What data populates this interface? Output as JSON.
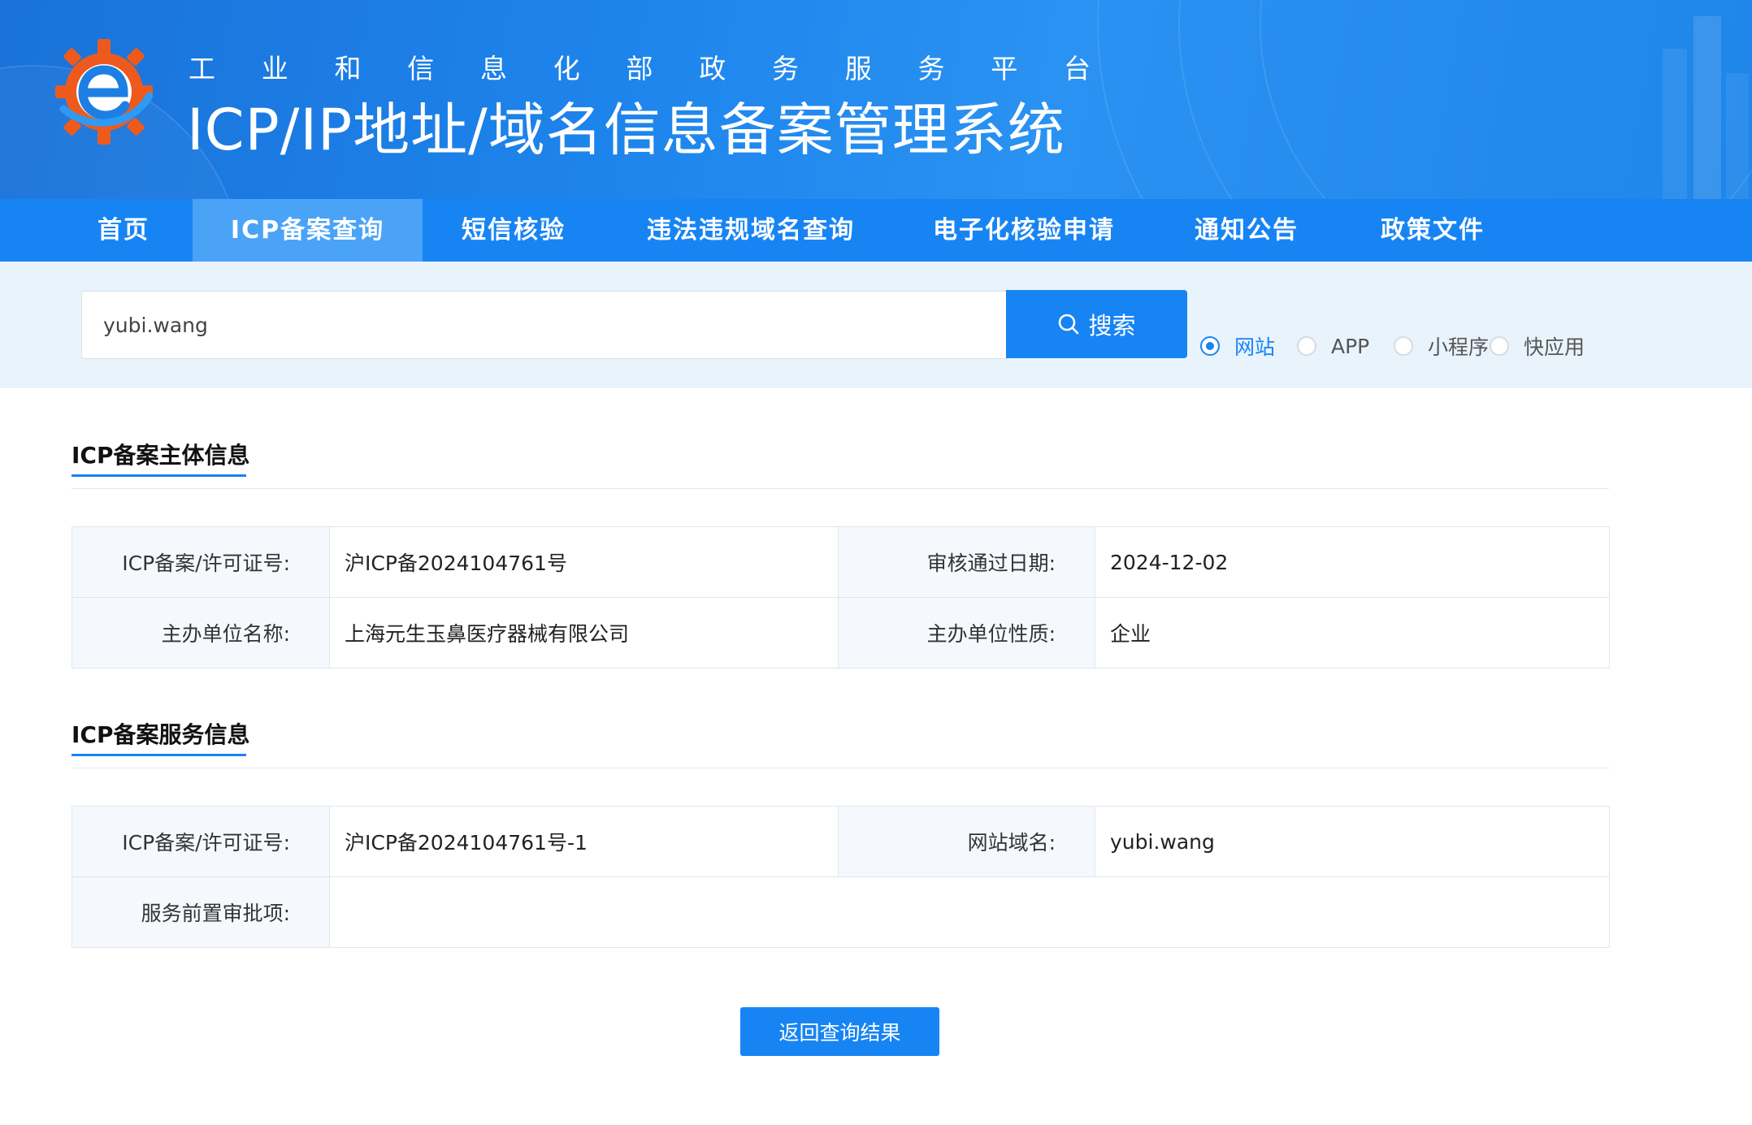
{
  "header": {
    "subtitle_chars": [
      "工",
      "业",
      "和",
      "信",
      "息",
      "化",
      "部",
      "政",
      "务",
      "服",
      "务",
      "平",
      "台"
    ],
    "title": "ICP/IP地址/域名信息备案管理系统",
    "logo_icon": "miit-e-gear-logo-icon"
  },
  "nav": {
    "items": [
      "首页",
      "ICP备案查询",
      "短信核验",
      "违法违规域名查询",
      "电子化核验申请",
      "通知公告",
      "政策文件"
    ],
    "active_index": 1
  },
  "search": {
    "value": "yubi.wang",
    "button_label": "搜索",
    "button_icon": "search-icon",
    "types": [
      {
        "label": "网站",
        "checked": true
      },
      {
        "label": "APP",
        "checked": false
      },
      {
        "label": "小程序",
        "checked": false
      },
      {
        "label": "快应用",
        "checked": false
      }
    ]
  },
  "subject_section": {
    "title": "ICP备案主体信息",
    "rows": [
      {
        "label1": "ICP备案/许可证号:",
        "value1": "沪ICP备2024104761号",
        "label2": "审核通过日期:",
        "value2": "2024-12-02"
      },
      {
        "label1": "主办单位名称:",
        "value1": "上海元生玉鼻医疗器械有限公司",
        "label2": "主办单位性质:",
        "value2": "企业"
      }
    ]
  },
  "service_section": {
    "title": "ICP备案服务信息",
    "rows": [
      {
        "label1": "ICP备案/许可证号:",
        "value1": "沪ICP备2024104761号-1",
        "label2": "网站域名:",
        "value2": "yubi.wang"
      },
      {
        "label1": "服务前置审批项:",
        "value1": ""
      }
    ]
  },
  "back_button_label": "返回查询结果",
  "colors": {
    "primary": "#1784f4",
    "nav_active": "#4aa3f7",
    "search_band": "#e9f3fc",
    "label_cell": "#f5f9fd",
    "logo_orange": "#ee5a1e"
  }
}
